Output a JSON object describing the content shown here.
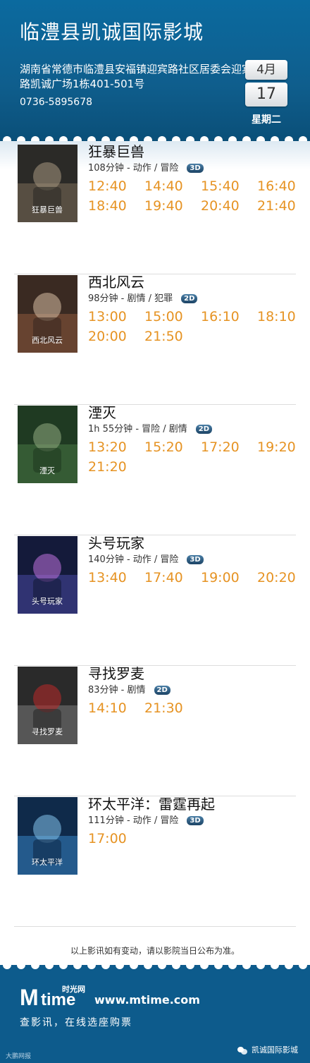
{
  "header": {
    "cinema_name": "临澧县凯诚国际影城",
    "address": "湖南省常德市临澧县安福镇迎宾路社区居委会迎宾路凯诚广场1栋401-501号",
    "phone": "0736-5895678",
    "date": {
      "month": "4月",
      "day": "17",
      "weekday": "星期二"
    }
  },
  "movies": [
    {
      "title": "狂暴巨兽",
      "info": "108分钟 - 动作 / 冒险",
      "format": "3D",
      "poster_icon": "movie-poster-rampage",
      "poster_text": "狂暴巨兽",
      "showtimes": [
        "12:40",
        "14:40",
        "15:40",
        "16:40",
        "18:40",
        "19:40",
        "20:40",
        "21:40"
      ]
    },
    {
      "title": "西北风云",
      "info": "98分钟 - 剧情 / 犯罪",
      "format": "2D",
      "poster_icon": "movie-poster-xibei",
      "poster_text": "西北风云",
      "showtimes": [
        "13:00",
        "15:00",
        "16:10",
        "18:10",
        "20:00",
        "21:50"
      ]
    },
    {
      "title": "湮灭",
      "info": "1h 55分钟 - 冒险 / 剧情",
      "format": "2D",
      "poster_icon": "movie-poster-annihilation",
      "poster_text": "湮灭",
      "showtimes": [
        "13:20",
        "15:20",
        "17:20",
        "19:20",
        "21:20"
      ]
    },
    {
      "title": "头号玩家",
      "info": "140分钟 - 动作 / 冒险",
      "format": "3D",
      "poster_icon": "movie-poster-ready-player-one",
      "poster_text": "头号玩家",
      "showtimes": [
        "13:40",
        "17:40",
        "19:00",
        "20:20"
      ]
    },
    {
      "title": "寻找罗麦",
      "info": "83分钟 - 剧情",
      "format": "2D",
      "poster_icon": "movie-poster-luomai",
      "poster_text": "寻找罗麦",
      "showtimes": [
        "14:10",
        "21:30"
      ]
    },
    {
      "title": "环太平洋：雷霆再起",
      "info": "111分钟 - 动作 / 冒险",
      "format": "3D",
      "poster_icon": "movie-poster-pacific-rim",
      "poster_text": "环太平洋",
      "showtimes": [
        "17:00"
      ]
    }
  ],
  "notice": "以上影讯如有变动，请以影院当日公布为准。",
  "footer": {
    "logo_m": "M",
    "logo_time": "time",
    "logo_cn": "时光网",
    "site_url": "www.mtime.com",
    "slogan": "查影讯，在线选座购票",
    "watermark_left": "大鹏网报",
    "watermark_right": "凯诚国际影城"
  },
  "colors": {
    "header_blue": "#0f5e8d",
    "showtime_orange": "#e69323",
    "footer_blue": "#0d5b8c"
  }
}
